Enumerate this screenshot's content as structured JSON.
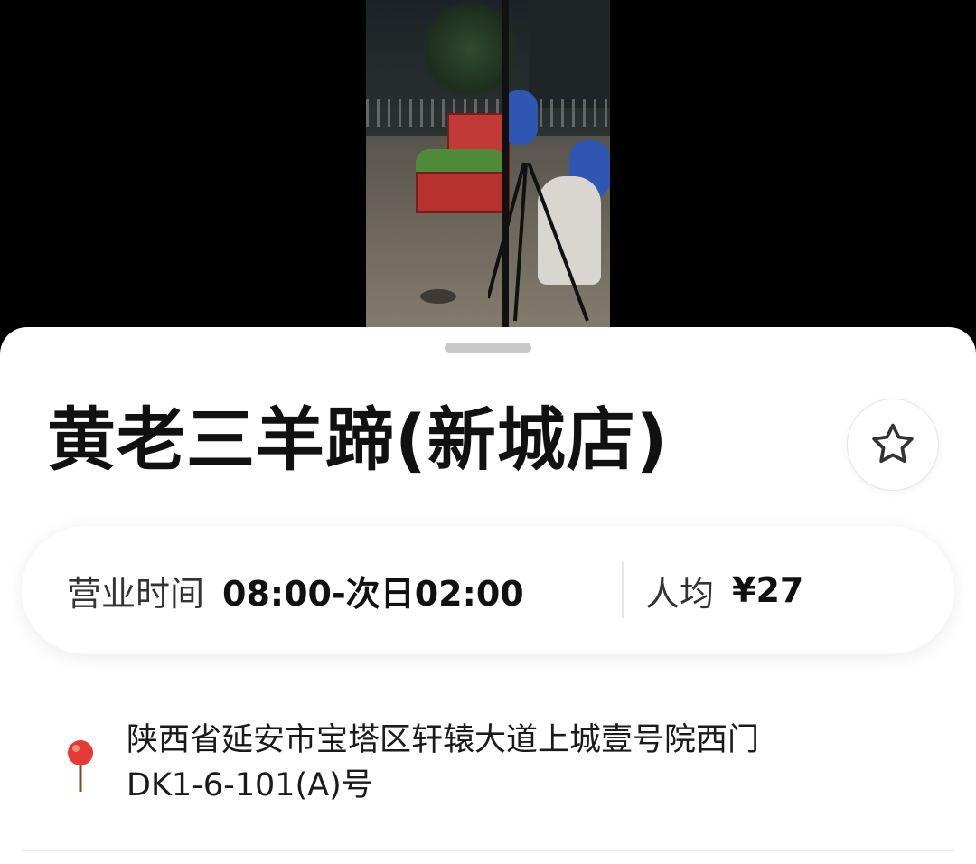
{
  "place": {
    "name": "黄老三羊蹄(新城店)",
    "hours_label": "营业时间",
    "hours_value": "08:00-次日02:00",
    "avg_label": "人均",
    "avg_value": "¥27",
    "address_line1": "陕西省延安市宝塔区轩辕大道上城壹号院西门",
    "address_line2": "DK1-6-101(A)号"
  },
  "icons": {
    "favorite": "star-icon",
    "location": "map-pin-icon"
  },
  "colors": {
    "pin_red": "#e53935",
    "title": "#111111",
    "sheet_bg": "#ffffff"
  }
}
